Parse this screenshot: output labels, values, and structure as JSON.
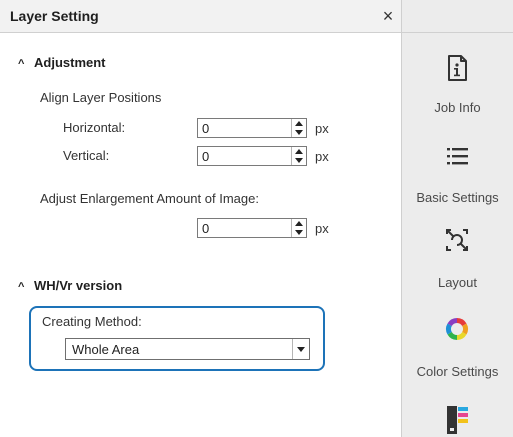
{
  "panel": {
    "title": "Layer Setting",
    "close_glyph": "×"
  },
  "adjustment": {
    "caret": "^",
    "heading": "Adjustment",
    "align_label": "Align Layer Positions",
    "horizontal_label": "Horizontal:",
    "horizontal_value": "0",
    "vertical_label": "Vertical:",
    "vertical_value": "0",
    "enlarge_label": "Adjust Enlargement Amount of Image:",
    "enlarge_value": "0",
    "unit": "px"
  },
  "whvr": {
    "caret": "^",
    "heading": "WH/Vr version",
    "creating_method_label": "Creating Method:",
    "creating_method_value": "Whole Area"
  },
  "sidebar": {
    "items": [
      {
        "label": "Job Info",
        "icon": "info-icon"
      },
      {
        "label": "Basic Settings",
        "icon": "list-icon"
      },
      {
        "label": "Layout",
        "icon": "layout-icon"
      },
      {
        "label": "Color Settings",
        "icon": "color-wheel-icon"
      },
      {
        "label": "",
        "icon": "swatch-icon"
      }
    ]
  },
  "colors": {
    "accent": "#1d73b8",
    "sidebar_bg": "#ececec",
    "header_bg": "#f2f2f2"
  }
}
